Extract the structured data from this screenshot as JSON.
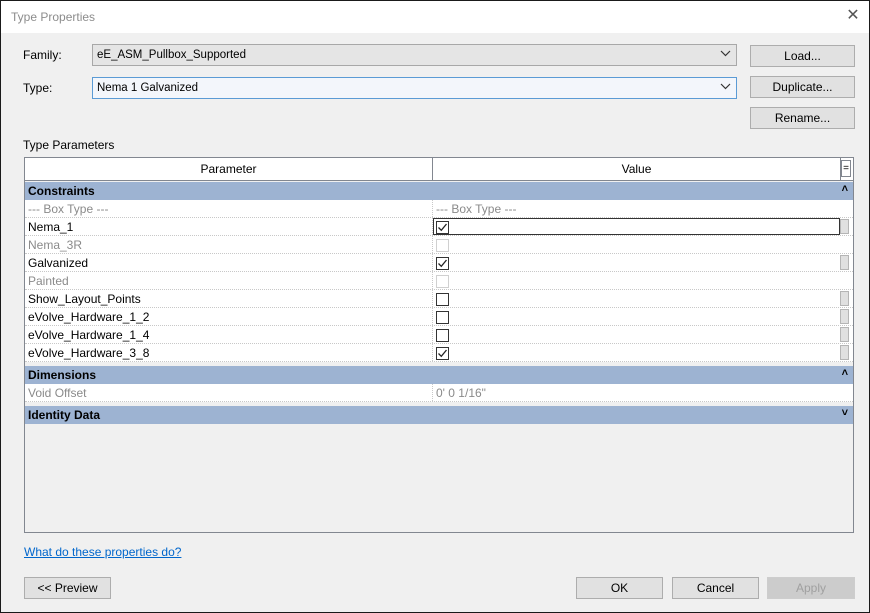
{
  "window": {
    "title": "Type Properties"
  },
  "family": {
    "label": "Family:",
    "value": "eE_ASM_Pullbox_Supported"
  },
  "type": {
    "label": "Type:",
    "value": "Nema 1 Galvanized"
  },
  "buttons": {
    "load": "Load...",
    "duplicate": "Duplicate...",
    "rename": "Rename...",
    "preview": "<< Preview",
    "ok": "OK",
    "cancel": "Cancel",
    "apply": "Apply"
  },
  "section_label": "Type Parameters",
  "grid": {
    "col_parameter": "Parameter",
    "col_value": "Value",
    "col_sort": "=",
    "groups": {
      "constraints": {
        "label": "Constraints",
        "collapse": "˄"
      },
      "dimensions": {
        "label": "Dimensions",
        "collapse": "˄"
      },
      "identity": {
        "label": "Identity Data",
        "collapse": "˅"
      }
    },
    "rows": [
      {
        "param": "---  Box Type  ---",
        "value": "---  Box Type  ---"
      },
      {
        "param": "Nema_1"
      },
      {
        "param": "Nema_3R"
      },
      {
        "param": "Galvanized"
      },
      {
        "param": "Painted"
      },
      {
        "param": "Show_Layout_Points"
      },
      {
        "param": "eVolve_Hardware_1_2"
      },
      {
        "param": "eVolve_Hardware_1_4"
      },
      {
        "param": "eVolve_Hardware_3_8"
      },
      {
        "param": "Void Offset",
        "value": "0'  0 1/16\""
      }
    ]
  },
  "help_link": "What do these properties do?",
  "colors": {
    "group_header": "#9db3d2",
    "link": "#0066cc",
    "disabled_text": "#8a8a8a"
  }
}
